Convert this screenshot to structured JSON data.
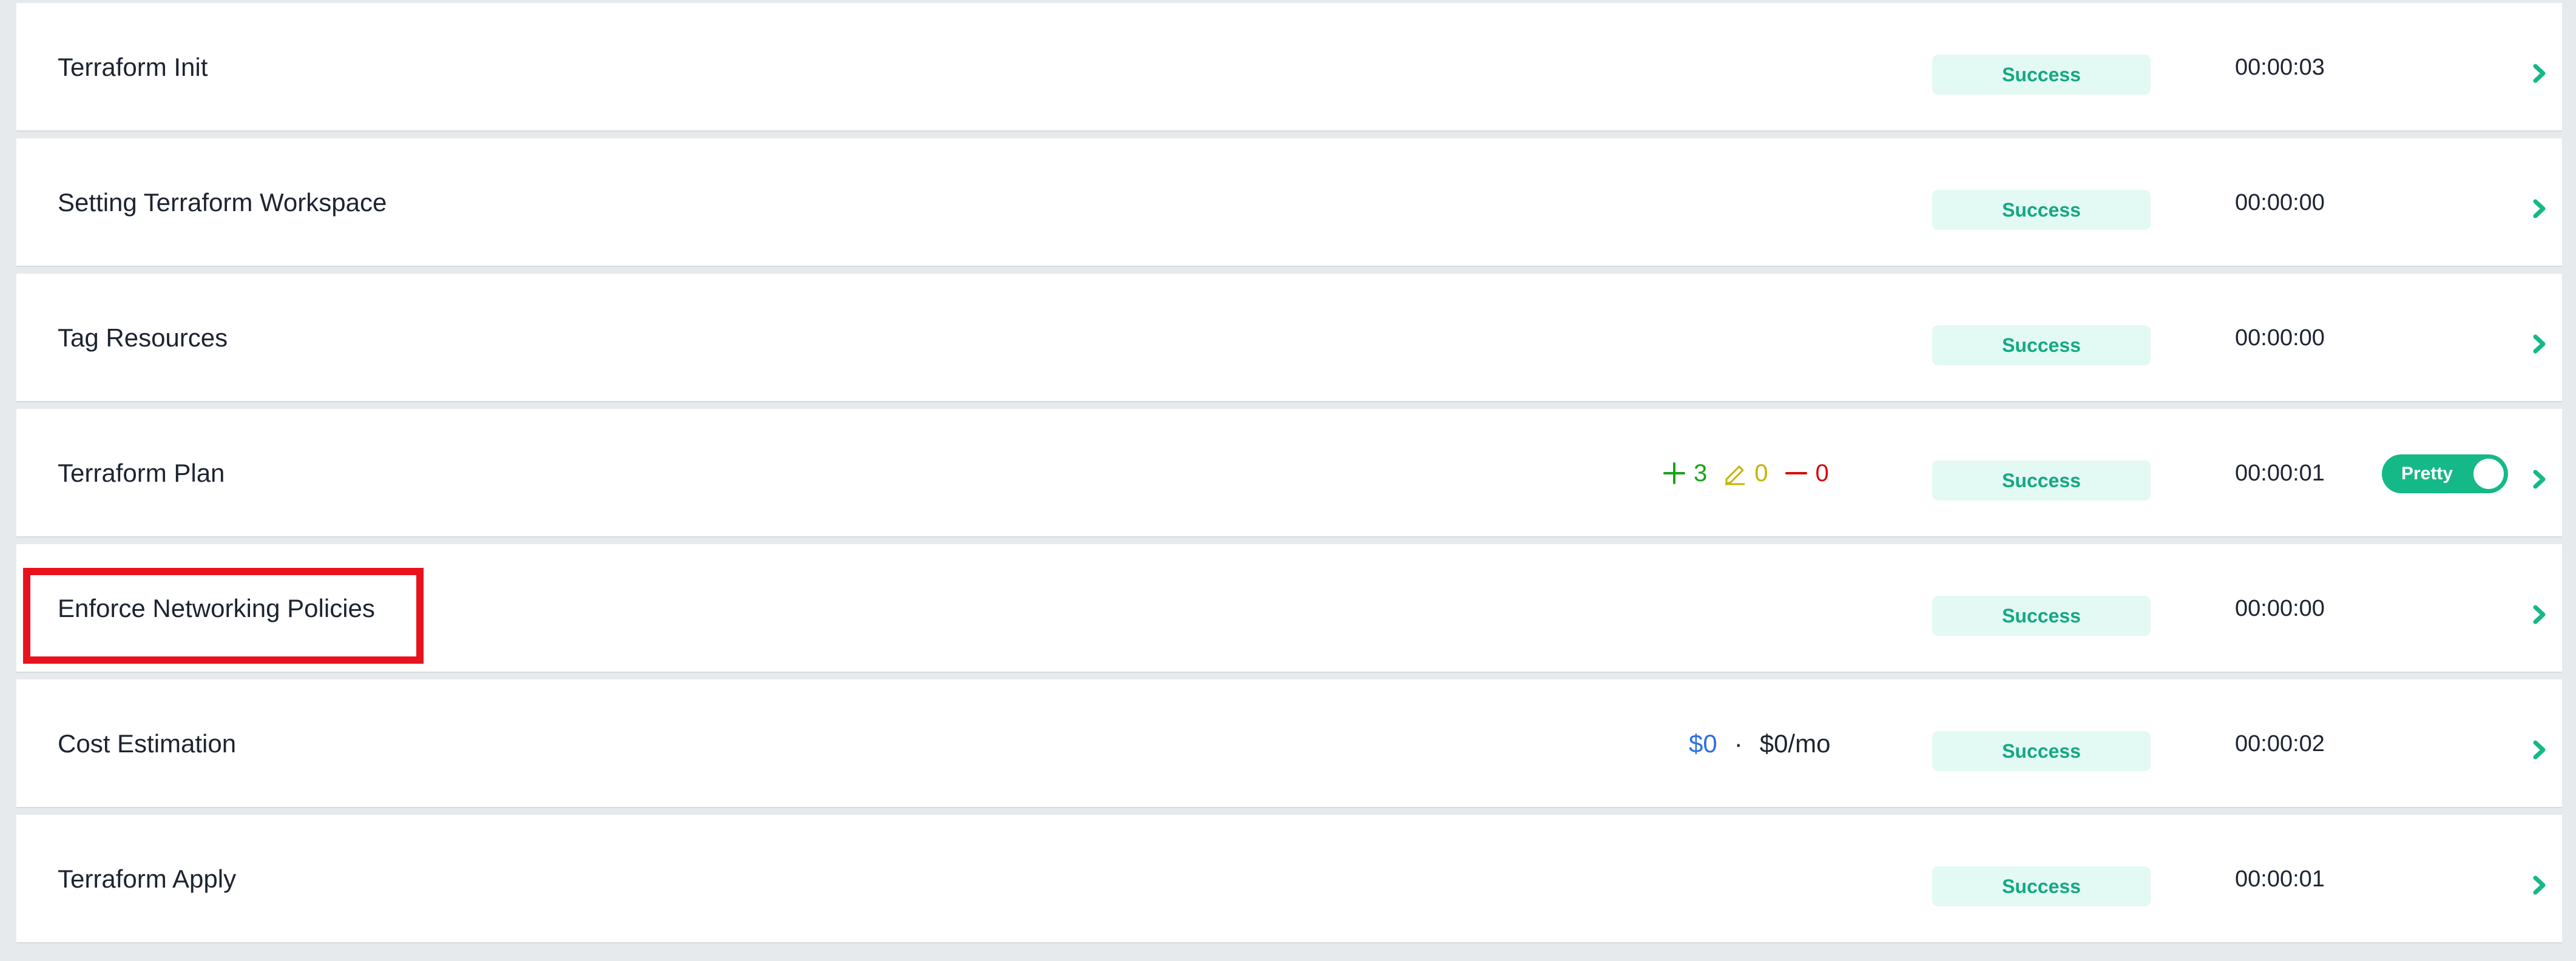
{
  "steps": [
    {
      "name": "Terraform Init",
      "status": "Success",
      "duration": "00:00:03"
    },
    {
      "name": "Setting Terraform Workspace",
      "status": "Success",
      "duration": "00:00:00"
    },
    {
      "name": "Tag Resources",
      "status": "Success",
      "duration": "00:00:00"
    },
    {
      "name": "Terraform Plan",
      "status": "Success",
      "duration": "00:00:01"
    },
    {
      "name": "Enforce Networking Policies",
      "status": "Success",
      "duration": "00:00:00"
    },
    {
      "name": "Cost Estimation",
      "status": "Success",
      "duration": "00:00:02"
    },
    {
      "name": "Terraform Apply",
      "status": "Success",
      "duration": "00:00:01"
    }
  ],
  "plan_changes": {
    "add_icon": "plus-icon",
    "add": "3",
    "change_icon": "pencil-icon",
    "change": "0",
    "destroy_icon": "minus-icon",
    "destroy": "0"
  },
  "cost": {
    "now": "$0",
    "separator": "·",
    "monthly": "$0/mo"
  },
  "toggle": {
    "label": "Pretty",
    "state": "on"
  },
  "colors": {
    "success_bg": "#e3f9f3",
    "success_text": "#14a884",
    "toggle_on": "#15b887",
    "add": "#18a317",
    "change": "#c6b300",
    "destroy": "#d40d0d",
    "cost_blue": "#2f6fe0",
    "highlight": "#e8121c"
  }
}
